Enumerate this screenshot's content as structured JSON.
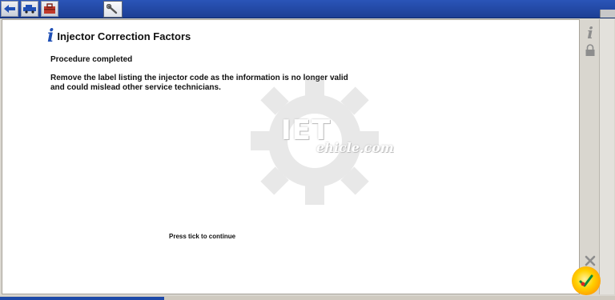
{
  "toolbar": {
    "buttons": [
      {
        "icon": "back-arrow-icon"
      },
      {
        "icon": "vehicle-icon"
      },
      {
        "icon": "toolbox-icon"
      },
      {
        "icon": "wrench-icon"
      }
    ],
    "accent": "#1d3f94"
  },
  "dialog": {
    "icon": "info-icon",
    "title": "Injector Correction Factors",
    "status": "Procedure completed",
    "message": "Remove the label listing the injector code as the information is no longer valid and could mislead other service technicians.",
    "prompt": "Press tick to continue"
  },
  "side": {
    "info_icon": "info-icon",
    "lock_icon": "lock-icon",
    "cancel_icon": "cross-icon",
    "confirm_icon": "tick-icon"
  },
  "watermark": {
    "text": "IET",
    "sub": "ehicle.com"
  }
}
